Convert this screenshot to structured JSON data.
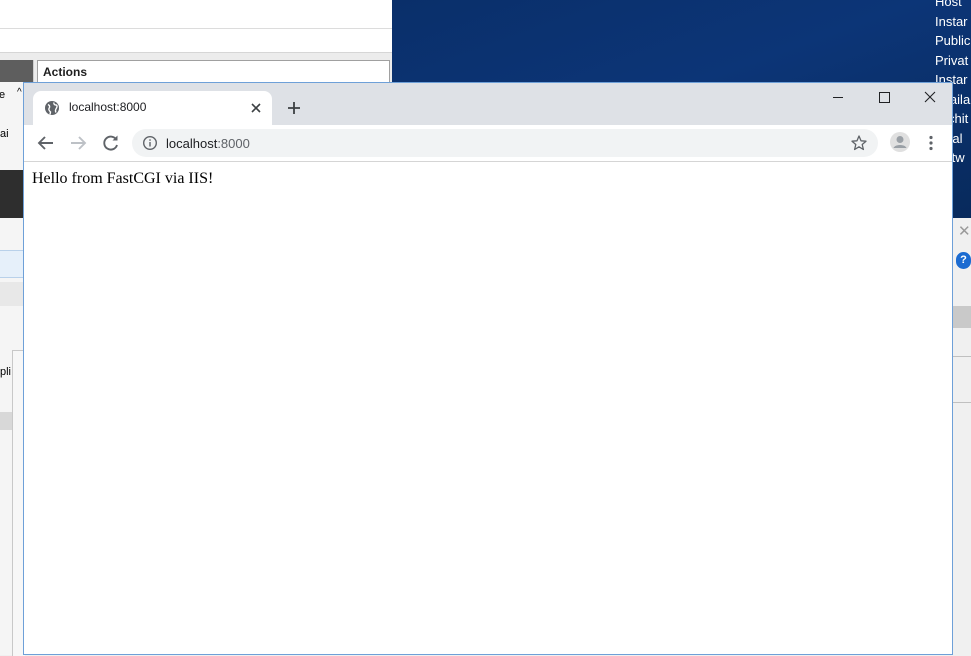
{
  "background": {
    "iis_fragments": {
      "frag_e": "e",
      "frag_ai": "ai",
      "frag_pli": "pli"
    },
    "actions_title": "Actions",
    "server_info_lines": [
      "Host",
      "Instar",
      "Public",
      "Privat",
      "Instar",
      "Availa",
      "Archit",
      "Total",
      "Netw"
    ],
    "help_glyph": "?"
  },
  "browser": {
    "tab": {
      "title": "localhost:8000"
    },
    "address_bar": {
      "host": "localhost",
      "rest": ":8000"
    },
    "page": {
      "text": "Hello from FastCGI via IIS!"
    }
  },
  "icons": [
    "globe-icon",
    "close-icon",
    "plus-icon",
    "minimize-icon",
    "maximize-icon",
    "back-arrow-icon",
    "forward-arrow-icon",
    "reload-icon",
    "info-icon",
    "star-icon",
    "profile-icon",
    "kebab-menu-icon"
  ],
  "colors": {
    "titlebar": "#dee1e6",
    "omnibox": "#f1f3f4",
    "desktop": "#0c3577",
    "window_border": "#6ea0d8"
  }
}
